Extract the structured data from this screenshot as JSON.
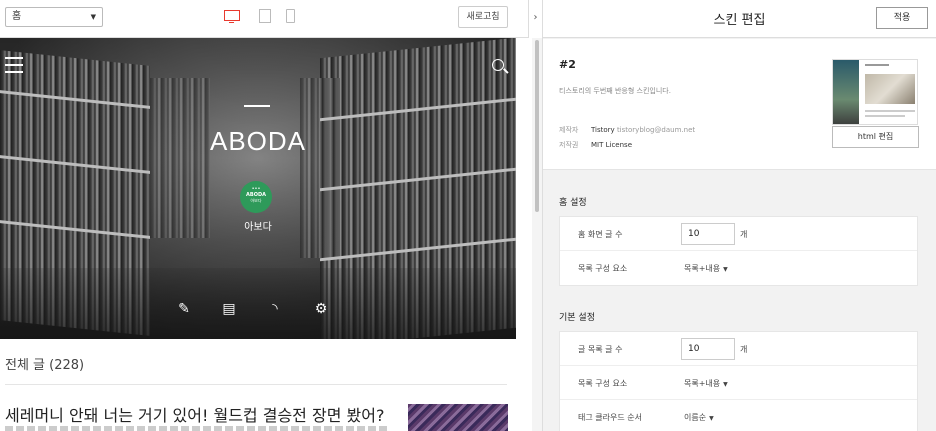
{
  "preview": {
    "page_select": "홈",
    "refresh_label": "새로고침",
    "collapse_icon": "›",
    "hero_title": "ABODA",
    "avatar": {
      "line1": "•••",
      "line2": "ABODA",
      "line3": "아보다"
    },
    "nickname": "아보다",
    "hero_icons": [
      "pencil-icon",
      "notebook-icon",
      "rss-icon",
      "gear-icon"
    ],
    "total_posts": "전체 글 (228)",
    "post_title": "세레머니 안돼 너는 거기 있어! 월드컵 결승전 장면 봤어?"
  },
  "editor": {
    "title": "스킨 편집",
    "apply_label": "적용",
    "skin": {
      "name": "#2",
      "description": "티스토리의 두번째 반응형 스킨입니다.",
      "maker_label": "제작자",
      "maker_name": "Tistory",
      "maker_email": "tistoryblog@daum.net",
      "license_label": "저작권",
      "license_value": "MIT License",
      "html_edit_label": "html 편집"
    },
    "home_settings": {
      "title": "홈 설정",
      "rows": [
        {
          "label": "홈 화면 글 수",
          "value": "10",
          "unit": "개"
        },
        {
          "label": "목록 구성 요소",
          "value": "목록+내용"
        }
      ]
    },
    "basic_settings": {
      "title": "기본 설정",
      "rows": [
        {
          "label": "글 목록 글 수",
          "value": "10",
          "unit": "개"
        },
        {
          "label": "목록 구성 요소",
          "value": "목록+내용"
        },
        {
          "label": "태그 클라우드 순서",
          "value": "이름순"
        }
      ]
    }
  },
  "colors": {
    "accent": "#e83a2f",
    "avatar_bg": "#2e9a5a"
  }
}
